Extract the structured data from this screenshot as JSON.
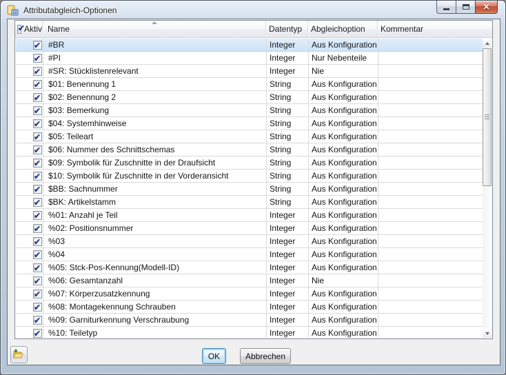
{
  "window": {
    "title": "Attributabgleich-Optionen",
    "icons": {
      "app": "table-document-icon",
      "minimize": "minimize-icon",
      "maximize": "maximize-icon",
      "close": "close-icon"
    }
  },
  "table": {
    "columns": [
      "Aktiv",
      "Name",
      "Datentyp",
      "Abgleichoption",
      "Kommentar"
    ],
    "sort": {
      "column": "Name",
      "direction": "ascending"
    },
    "select_all_checked": true,
    "rows": [
      {
        "checked": true,
        "selected": true,
        "name": "#BR",
        "datentyp": "Integer",
        "abgleichoption": "Aus Konfiguration",
        "kommentar": ""
      },
      {
        "checked": true,
        "selected": false,
        "name": "#PI",
        "datentyp": "Integer",
        "abgleichoption": "Nur Nebenteile",
        "kommentar": ""
      },
      {
        "checked": true,
        "selected": false,
        "name": "#SR: Stücklistenrelevant",
        "datentyp": "Integer",
        "abgleichoption": "Nie",
        "kommentar": ""
      },
      {
        "checked": true,
        "selected": false,
        "name": "$01: Benennung 1",
        "datentyp": "String",
        "abgleichoption": "Aus Konfiguration",
        "kommentar": ""
      },
      {
        "checked": true,
        "selected": false,
        "name": "$02: Benennung 2",
        "datentyp": "String",
        "abgleichoption": "Aus Konfiguration",
        "kommentar": ""
      },
      {
        "checked": true,
        "selected": false,
        "name": "$03: Bemerkung",
        "datentyp": "String",
        "abgleichoption": "Aus Konfiguration",
        "kommentar": ""
      },
      {
        "checked": true,
        "selected": false,
        "name": "$04: Systemhinweise",
        "datentyp": "String",
        "abgleichoption": "Aus Konfiguration",
        "kommentar": ""
      },
      {
        "checked": true,
        "selected": false,
        "name": "$05: Teileart",
        "datentyp": "String",
        "abgleichoption": "Aus Konfiguration",
        "kommentar": ""
      },
      {
        "checked": true,
        "selected": false,
        "name": "$06: Nummer des Schnittschemas",
        "datentyp": "String",
        "abgleichoption": "Aus Konfiguration",
        "kommentar": ""
      },
      {
        "checked": true,
        "selected": false,
        "name": "$09: Symbolik für Zuschnitte in der Draufsicht",
        "datentyp": "String",
        "abgleichoption": "Aus Konfiguration",
        "kommentar": ""
      },
      {
        "checked": true,
        "selected": false,
        "name": "$10: Symbolik für Zuschnitte in der Vorderansicht",
        "datentyp": "String",
        "abgleichoption": "Aus Konfiguration",
        "kommentar": ""
      },
      {
        "checked": true,
        "selected": false,
        "name": "$BB: Sachnummer",
        "datentyp": "String",
        "abgleichoption": "Aus Konfiguration",
        "kommentar": ""
      },
      {
        "checked": true,
        "selected": false,
        "name": "$BK: Artikelstamm",
        "datentyp": "String",
        "abgleichoption": "Aus Konfiguration",
        "kommentar": ""
      },
      {
        "checked": true,
        "selected": false,
        "name": "%01: Anzahl je Teil",
        "datentyp": "Integer",
        "abgleichoption": "Aus Konfiguration",
        "kommentar": ""
      },
      {
        "checked": true,
        "selected": false,
        "name": "%02: Positionsnummer",
        "datentyp": "Integer",
        "abgleichoption": "Aus Konfiguration",
        "kommentar": ""
      },
      {
        "checked": true,
        "selected": false,
        "name": "%03",
        "datentyp": "Integer",
        "abgleichoption": "Aus Konfiguration",
        "kommentar": ""
      },
      {
        "checked": true,
        "selected": false,
        "name": "%04",
        "datentyp": "Integer",
        "abgleichoption": "Aus Konfiguration",
        "kommentar": ""
      },
      {
        "checked": true,
        "selected": false,
        "name": "%05: Stck-Pos-Kennung(Modell-ID)",
        "datentyp": "Integer",
        "abgleichoption": "Aus Konfiguration",
        "kommentar": ""
      },
      {
        "checked": true,
        "selected": false,
        "name": "%06: Gesamtanzahl",
        "datentyp": "Integer",
        "abgleichoption": "Nie",
        "kommentar": ""
      },
      {
        "checked": true,
        "selected": false,
        "name": "%07: Körperzusatzkennung",
        "datentyp": "Integer",
        "abgleichoption": "Aus Konfiguration",
        "kommentar": ""
      },
      {
        "checked": true,
        "selected": false,
        "name": "%08: Montagekennung Schrauben",
        "datentyp": "Integer",
        "abgleichoption": "Aus Konfiguration",
        "kommentar": ""
      },
      {
        "checked": true,
        "selected": false,
        "name": "%09: Garniturkennung Verschraubung",
        "datentyp": "Integer",
        "abgleichoption": "Aus Konfiguration",
        "kommentar": ""
      },
      {
        "checked": true,
        "selected": false,
        "name": "%10: Teiletyp",
        "datentyp": "Integer",
        "abgleichoption": "Aus Konfiguration",
        "kommentar": ""
      }
    ]
  },
  "footer": {
    "ok_label": "OK",
    "cancel_label": "Abbrechen",
    "load_button_icon": "open-folder-icon"
  },
  "colors": {
    "selection": "#cfe4f9",
    "titlebar": "#c3d2e2",
    "close_button": "#c35037",
    "ok_focus_ring": "#a8dbf4",
    "checkbox_check": "#2c3f92"
  }
}
